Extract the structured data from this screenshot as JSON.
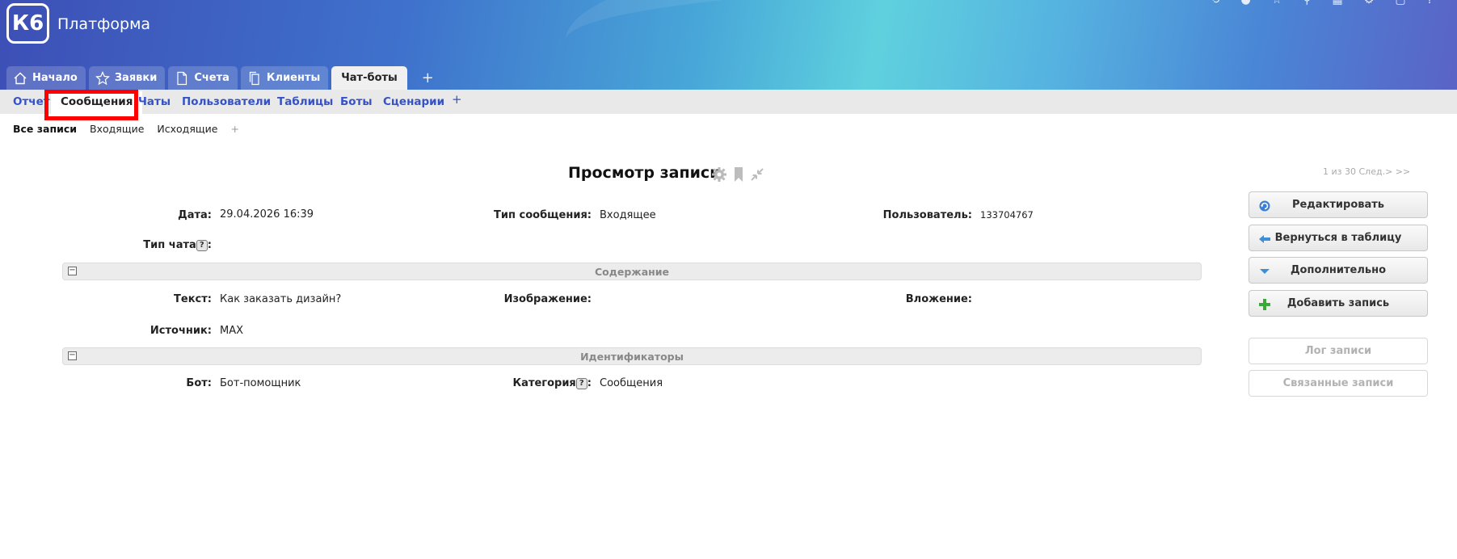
{
  "app": {
    "logo": "К6",
    "title": "Платформа"
  },
  "main_tabs": [
    {
      "label": "Начало",
      "icon": "home-icon"
    },
    {
      "label": "Заявки",
      "icon": "star-icon"
    },
    {
      "label": "Счета",
      "icon": "document-icon"
    },
    {
      "label": "Клиенты",
      "icon": "copy-icon"
    },
    {
      "label": "Чат-боты",
      "icon": ""
    }
  ],
  "main_tabs_add": "+",
  "sub_tabs": [
    "Отчет",
    "Сообщения",
    "Чаты",
    "Пользователи",
    "Таблицы",
    "Боты",
    "Сценарии"
  ],
  "sub_tabs_add": "+",
  "filters": {
    "all": "Все записи",
    "incoming": "Входящие",
    "outgoing": "Исходящие",
    "add": "+"
  },
  "page_title": "Просмотр записи",
  "pager": "1 из 30 След.> >>",
  "fields": {
    "date_label": "Дата:",
    "date_value": "29.04.2026 16:39",
    "msgtype_label": "Тип сообщения:",
    "msgtype_value": "Входящее",
    "user_label": "Пользователь:",
    "user_value": "133704767",
    "chattype_label": "Тип чата",
    "text_label": "Текст:",
    "text_value": "Как заказать дизайн?",
    "image_label": "Изображение:",
    "attachment_label": "Вложение:",
    "source_label": "Источник:",
    "source_value": "MAX",
    "bot_label": "Бот:",
    "bot_value": "Бот-помощник",
    "category_label": "Категория",
    "category_value": "Сообщения",
    "help": "?",
    "colon": ":"
  },
  "sections": {
    "content": "Содержание",
    "identifiers": "Идентификаторы"
  },
  "buttons": {
    "edit": "Редактировать",
    "back": "Вернуться в таблицу",
    "more": "Дополнительно",
    "add": "Добавить запись",
    "log": "Лог записи",
    "related": "Связанные записи"
  },
  "colors": {
    "accent": "#3552c7",
    "highlight": "#ff0000"
  }
}
